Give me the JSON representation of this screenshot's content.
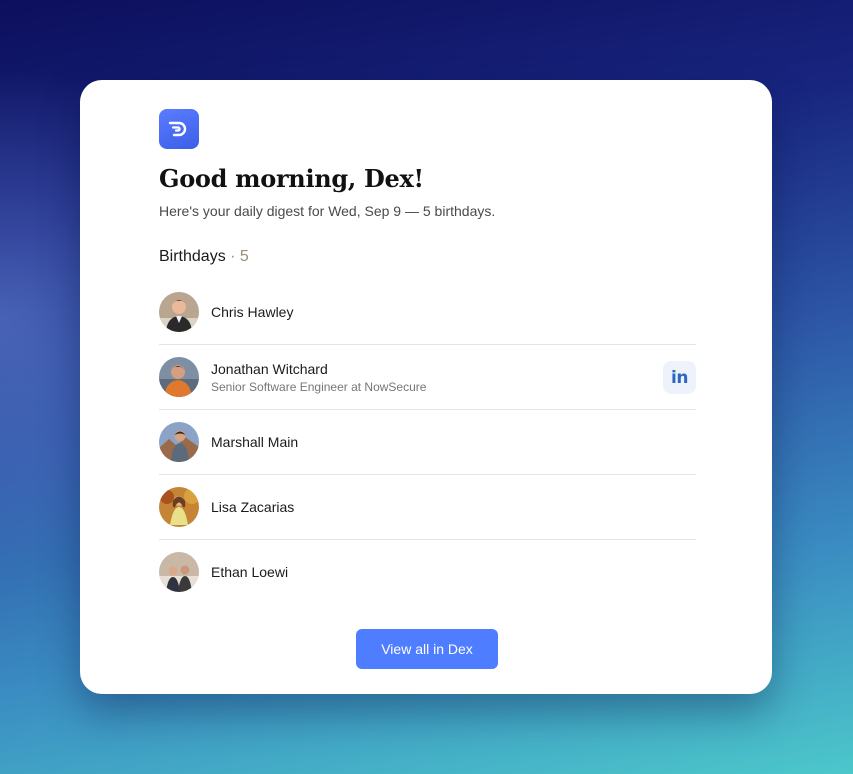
{
  "digest": {
    "greeting": "Good morning, Dex!",
    "subtitle": "Here's your daily digest for Wed, Sep 9 — 5 birthdays."
  },
  "birthdays": {
    "title": "Birthdays",
    "separator": " · ",
    "count": "5",
    "people": [
      {
        "name": "Chris Hawley",
        "job": "",
        "avatar_bg": "#b9a590"
      },
      {
        "name": "Jonathan Witchard",
        "job": "Senior Software Engineer at NowSecure",
        "avatar_bg": "#7e8fa4",
        "linkedin_icon": "linkedin-icon"
      },
      {
        "name": "Marshall Main",
        "job": "",
        "avatar_bg": "#8aa3c7"
      },
      {
        "name": "Lisa Zacarias",
        "job": "",
        "avatar_bg": "#c58436"
      },
      {
        "name": "Ethan Loewi",
        "job": "",
        "avatar_bg": "#c9b8a6"
      }
    ]
  },
  "footer": {
    "cta_label": "View all in Dex"
  },
  "colors": {
    "brand": "#4f7dff",
    "linkedin": "#2c67c4"
  }
}
